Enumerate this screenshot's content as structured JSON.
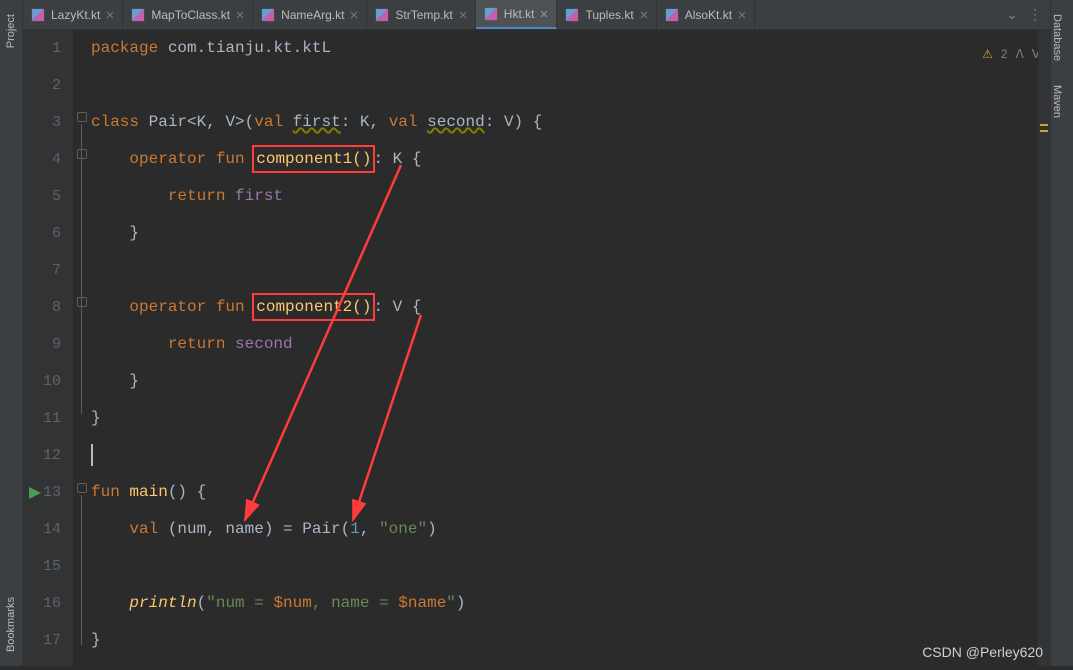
{
  "tabs": [
    {
      "label": "LazyKt.kt",
      "active": false
    },
    {
      "label": "MapToClass.kt",
      "active": false
    },
    {
      "label": "NameArg.kt",
      "active": false
    },
    {
      "label": "StrTemp.kt",
      "active": false
    },
    {
      "label": "Hkt.kt",
      "active": true
    },
    {
      "label": "Tuples.kt",
      "active": false
    },
    {
      "label": "AlsoKt.kt",
      "active": false
    }
  ],
  "leftRail": {
    "top": "Project",
    "bottom": "Bookmarks"
  },
  "rightRail": {
    "top": "Database",
    "mid": "Maven"
  },
  "status": {
    "warningGlyph": "⚠",
    "warningCount": "2",
    "up": "ᐱ",
    "down": "ᐯ"
  },
  "lines": [
    "1",
    "2",
    "3",
    "4",
    "5",
    "6",
    "7",
    "8",
    "9",
    "10",
    "11",
    "12",
    "13",
    "14",
    "15",
    "16",
    "17"
  ],
  "code": {
    "l1": {
      "kw": "package",
      "rest": " com.tianju.kt.ktL"
    },
    "l3": {
      "kw1": "class",
      "name": " Pair",
      "tp": "<K, V>(",
      "valkw": "val",
      "first": "first",
      "colon": ": K, ",
      "valkw2": "val",
      "second": "second",
      "close": ": V) {"
    },
    "l4": {
      "kw": "operator fun",
      "name": "component1()",
      "after": ": K {"
    },
    "l5": {
      "kw": "return",
      "v": " first"
    },
    "l6": {
      "close": "}"
    },
    "l8": {
      "kw": "operator fun",
      "name": "component2()",
      "after": ": V {"
    },
    "l9": {
      "kw": "return",
      "v": " second"
    },
    "l10": {
      "close": "}"
    },
    "l11": {
      "close": "}"
    },
    "l13": {
      "kw": "fun",
      "name": " main",
      "paren": "() {"
    },
    "l14": {
      "kw": "val",
      "pre": " (num, name) = Pair(",
      "num": "1",
      "mid": ", ",
      "str": "\"one\"",
      "post": ")"
    },
    "l16": {
      "fn": "println",
      "open": "(",
      "str": "\"num = ",
      "t1": "$num",
      "mid": ", name = ",
      "t2": "$name",
      "close": "\"",
      ")": ")"
    },
    "l17": {
      "close": "}"
    }
  },
  "watermark": "CSDN @Perley620"
}
